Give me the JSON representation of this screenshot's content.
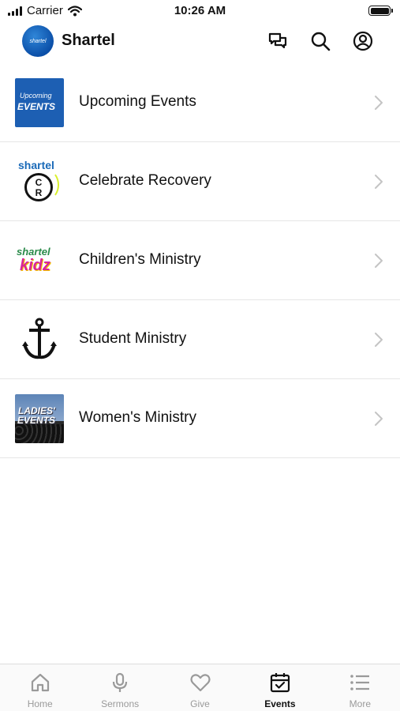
{
  "status_bar": {
    "carrier": "Carrier",
    "time": "10:26 AM"
  },
  "header": {
    "app_name": "Shartel",
    "logo_text": "shartel",
    "icons": [
      "chat-icon",
      "search-icon",
      "profile-icon"
    ]
  },
  "items": [
    {
      "label": "Upcoming Events",
      "thumb_text": [
        "Upcoming",
        "EVENTS"
      ],
      "icon": "chevron-right-icon"
    },
    {
      "label": "Celebrate Recovery",
      "thumb_text": [
        "shartel",
        "C",
        "R"
      ],
      "icon": "chevron-right-icon"
    },
    {
      "label": "Children's Ministry",
      "thumb_text": [
        "shartel",
        "kidz"
      ],
      "icon": "chevron-right-icon"
    },
    {
      "label": "Student Ministry",
      "thumb_text": [],
      "icon": "chevron-right-icon"
    },
    {
      "label": "Women's Ministry",
      "thumb_text": [
        "LADIES'",
        "EVENTS"
      ],
      "icon": "chevron-right-icon"
    }
  ],
  "tabs": [
    {
      "label": "Home",
      "icon": "home-icon",
      "active": false
    },
    {
      "label": "Sermons",
      "icon": "microphone-icon",
      "active": false
    },
    {
      "label": "Give",
      "icon": "heart-icon",
      "active": false
    },
    {
      "label": "Events",
      "icon": "calendar-icon",
      "active": true
    },
    {
      "label": "More",
      "icon": "list-icon",
      "active": false
    }
  ],
  "colors": {
    "accent": "#111111",
    "inactive_tab": "#9a9a9a",
    "logo_blue": "#0b4fa8",
    "divider": "#e6e6e6"
  }
}
